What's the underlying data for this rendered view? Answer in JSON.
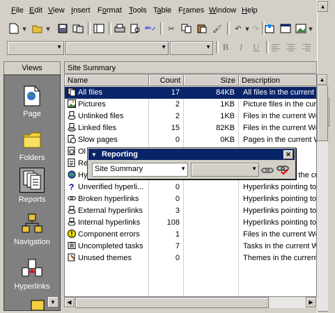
{
  "menu": {
    "items": [
      "File",
      "Edit",
      "View",
      "Insert",
      "Format",
      "Tools",
      "Table",
      "Frames",
      "Window",
      "Help"
    ],
    "underline": [
      "F",
      "E",
      "V",
      "I",
      "o",
      "T",
      "a",
      "r",
      "W",
      "H"
    ]
  },
  "views": {
    "title": "Views",
    "items": [
      {
        "label": "Page",
        "icon": "page-icon"
      },
      {
        "label": "Folders",
        "icon": "folder-icon"
      },
      {
        "label": "Reports",
        "icon": "reports-icon"
      },
      {
        "label": "Navigation",
        "icon": "navigation-icon"
      },
      {
        "label": "Hyperlinks",
        "icon": "hyperlinks-icon"
      }
    ]
  },
  "main": {
    "title": "Site Summary",
    "columns": [
      "Name",
      "Count",
      "Size",
      "Description"
    ],
    "rows": [
      {
        "name": "All files",
        "count": "17",
        "size": "84KB",
        "desc": "All files in the current",
        "icon": "all-files-icon",
        "selected": true
      },
      {
        "name": "Pictures",
        "count": "2",
        "size": "1KB",
        "desc": "Picture files in the cur",
        "icon": "picture-icon"
      },
      {
        "name": "Unlinked files",
        "count": "2",
        "size": "1KB",
        "desc": "Files in the current We",
        "icon": "unlinked-files-icon"
      },
      {
        "name": "Linked files",
        "count": "15",
        "size": "82KB",
        "desc": "Files in the current We",
        "icon": "linked-files-icon"
      },
      {
        "name": "Slow pages",
        "count": "0",
        "size": "0KB",
        "desc": "Pages in the current We",
        "icon": "slow-pages-icon"
      },
      {
        "name": "Ol",
        "count": "",
        "size": "",
        "desc": "ent We",
        "icon": "older-files-icon"
      },
      {
        "name": "Re",
        "count": "",
        "size": "",
        "desc": "ent We",
        "icon": "recent-files-icon"
      },
      {
        "name": "Hyperlinks",
        "count": "",
        "size": "",
        "desc": "All hyperlinks in the cu",
        "icon": "hyperlinks-row-icon"
      },
      {
        "name": "Unverified hyperli...",
        "count": "0",
        "size": "",
        "desc": "Hyperlinks pointing to",
        "icon": "question-icon"
      },
      {
        "name": "Broken hyperlinks",
        "count": "0",
        "size": "",
        "desc": "Hyperlinks pointing to",
        "icon": "broken-link-icon"
      },
      {
        "name": "External hyperlinks",
        "count": "3",
        "size": "",
        "desc": "Hyperlinks pointing to",
        "icon": "external-link-icon"
      },
      {
        "name": "Internal hyperlinks",
        "count": "108",
        "size": "",
        "desc": "Hyperlinks pointing to",
        "icon": "internal-link-icon"
      },
      {
        "name": "Component errors",
        "count": "1",
        "size": "",
        "desc": "Files in the current We",
        "icon": "warning-icon"
      },
      {
        "name": "Uncompleted tasks",
        "count": "7",
        "size": "",
        "desc": "Tasks in the current W",
        "icon": "tasks-icon"
      },
      {
        "name": "Unused themes",
        "count": "0",
        "size": "",
        "desc": "Themes in the current",
        "icon": "themes-icon"
      }
    ]
  },
  "reporting": {
    "title": "Reporting",
    "report_value": "Site Summary",
    "second_value": ""
  },
  "colors": {
    "selection": "#0a246a",
    "views_bg": "#808080",
    "chrome": "#d4d0c8"
  }
}
